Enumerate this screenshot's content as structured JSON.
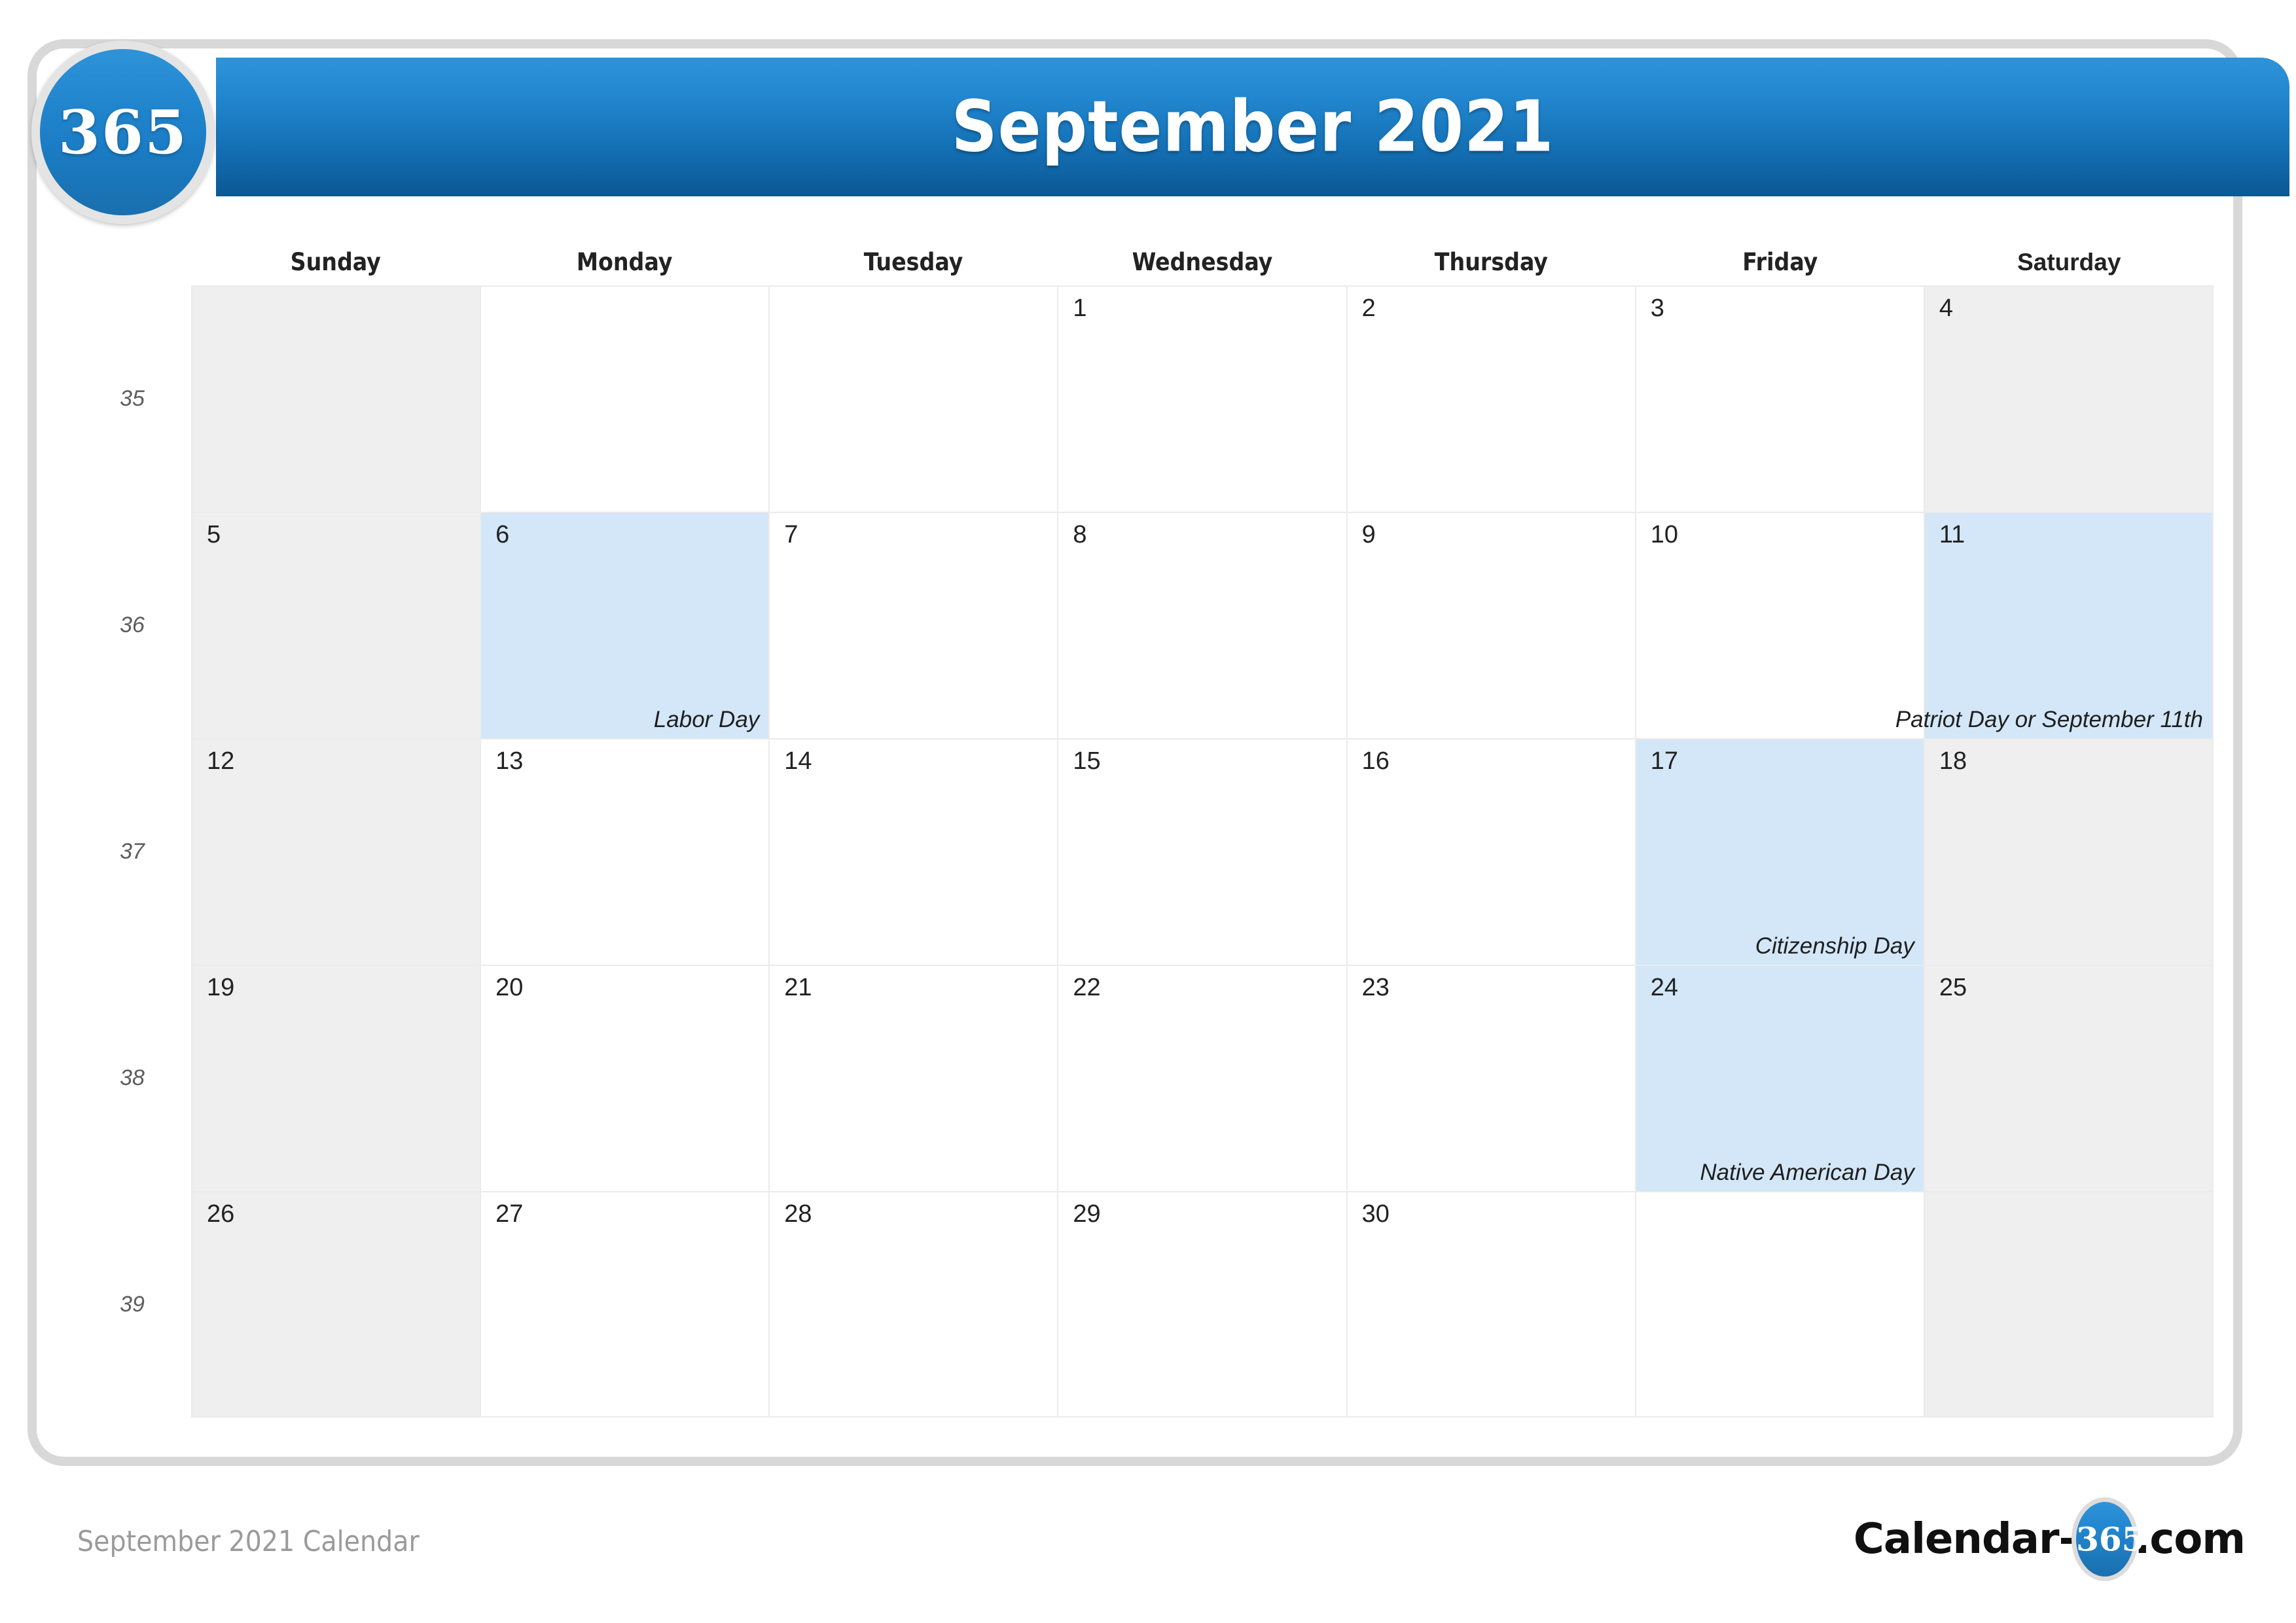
{
  "brand": {
    "badge_text": "365",
    "watermark_text": "365"
  },
  "header": {
    "title": "September 2021"
  },
  "weekdays": [
    {
      "label": "Sunday",
      "wide": false
    },
    {
      "label": "Monday",
      "wide": false
    },
    {
      "label": "Tuesday",
      "wide": false
    },
    {
      "label": "Wednesday",
      "wide": false
    },
    {
      "label": "Thursday",
      "wide": false
    },
    {
      "label": "Friday",
      "wide": false
    },
    {
      "label": "Saturday",
      "wide": true
    }
  ],
  "colors": {
    "header_top": "#2f93d9",
    "header_bottom": "#0b5894",
    "weekend_bg": "#efefef",
    "holiday_bg": "#d3e7f8",
    "grid_line": "#ebebeb",
    "frame_border": "#d8d8d8",
    "footer_text": "#9b9b9b"
  },
  "weeks": [
    {
      "week_number": "35",
      "days": [
        {
          "date": "",
          "holiday": "",
          "weekend": true,
          "is_holiday": false
        },
        {
          "date": "",
          "holiday": "",
          "weekend": false,
          "is_holiday": false
        },
        {
          "date": "",
          "holiday": "",
          "weekend": false,
          "is_holiday": false
        },
        {
          "date": "1",
          "holiday": "",
          "weekend": false,
          "is_holiday": false
        },
        {
          "date": "2",
          "holiday": "",
          "weekend": false,
          "is_holiday": false
        },
        {
          "date": "3",
          "holiday": "",
          "weekend": false,
          "is_holiday": false
        },
        {
          "date": "4",
          "holiday": "",
          "weekend": true,
          "is_holiday": false
        }
      ]
    },
    {
      "week_number": "36",
      "days": [
        {
          "date": "5",
          "holiday": "",
          "weekend": true,
          "is_holiday": false
        },
        {
          "date": "6",
          "holiday": "Labor Day",
          "weekend": false,
          "is_holiday": true
        },
        {
          "date": "7",
          "holiday": "",
          "weekend": false,
          "is_holiday": false
        },
        {
          "date": "8",
          "holiday": "",
          "weekend": false,
          "is_holiday": false
        },
        {
          "date": "9",
          "holiday": "",
          "weekend": false,
          "is_holiday": false
        },
        {
          "date": "10",
          "holiday": "",
          "weekend": false,
          "is_holiday": false
        },
        {
          "date": "11",
          "holiday": "Patriot Day or September 11th",
          "weekend": true,
          "is_holiday": true
        }
      ]
    },
    {
      "week_number": "37",
      "days": [
        {
          "date": "12",
          "holiday": "",
          "weekend": true,
          "is_holiday": false
        },
        {
          "date": "13",
          "holiday": "",
          "weekend": false,
          "is_holiday": false
        },
        {
          "date": "14",
          "holiday": "",
          "weekend": false,
          "is_holiday": false
        },
        {
          "date": "15",
          "holiday": "",
          "weekend": false,
          "is_holiday": false
        },
        {
          "date": "16",
          "holiday": "",
          "weekend": false,
          "is_holiday": false
        },
        {
          "date": "17",
          "holiday": "Citizenship Day",
          "weekend": false,
          "is_holiday": true
        },
        {
          "date": "18",
          "holiday": "",
          "weekend": true,
          "is_holiday": false
        }
      ]
    },
    {
      "week_number": "38",
      "days": [
        {
          "date": "19",
          "holiday": "",
          "weekend": true,
          "is_holiday": false
        },
        {
          "date": "20",
          "holiday": "",
          "weekend": false,
          "is_holiday": false
        },
        {
          "date": "21",
          "holiday": "",
          "weekend": false,
          "is_holiday": false
        },
        {
          "date": "22",
          "holiday": "",
          "weekend": false,
          "is_holiday": false
        },
        {
          "date": "23",
          "holiday": "",
          "weekend": false,
          "is_holiday": false
        },
        {
          "date": "24",
          "holiday": "Native American Day",
          "weekend": false,
          "is_holiday": true
        },
        {
          "date": "25",
          "holiday": "",
          "weekend": true,
          "is_holiday": false
        }
      ]
    },
    {
      "week_number": "39",
      "days": [
        {
          "date": "26",
          "holiday": "",
          "weekend": true,
          "is_holiday": false
        },
        {
          "date": "27",
          "holiday": "",
          "weekend": false,
          "is_holiday": false
        },
        {
          "date": "28",
          "holiday": "",
          "weekend": false,
          "is_holiday": false
        },
        {
          "date": "29",
          "holiday": "",
          "weekend": false,
          "is_holiday": false
        },
        {
          "date": "30",
          "holiday": "",
          "weekend": false,
          "is_holiday": false
        },
        {
          "date": "",
          "holiday": "",
          "weekend": false,
          "is_holiday": false
        },
        {
          "date": "",
          "holiday": "",
          "weekend": true,
          "is_holiday": false
        }
      ]
    }
  ],
  "footer": {
    "caption": "September 2021 Calendar",
    "logo_prefix": "Calendar-",
    "logo_badge": "365",
    "logo_suffix": ".com"
  }
}
